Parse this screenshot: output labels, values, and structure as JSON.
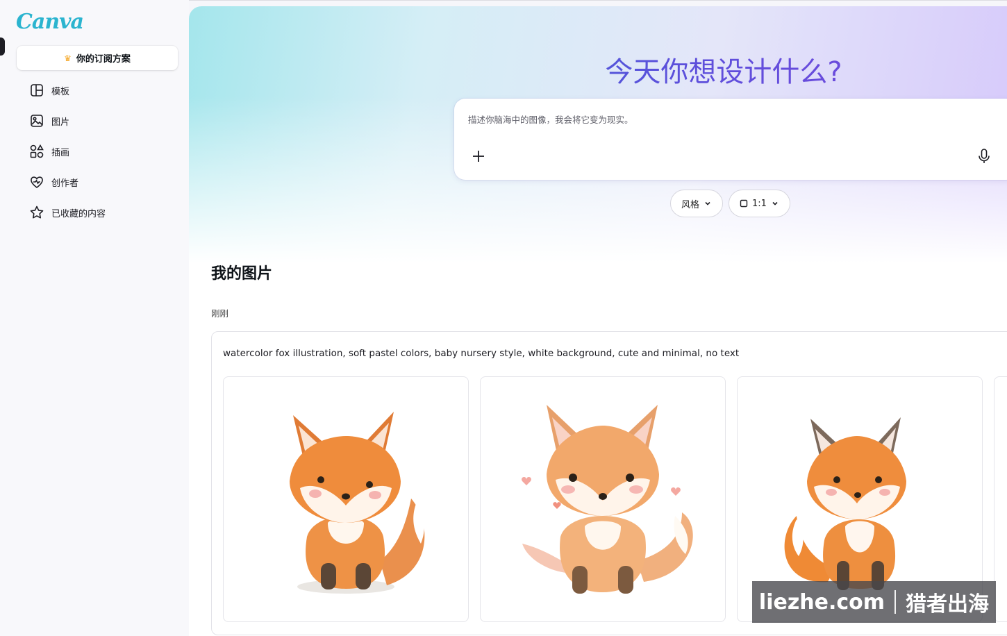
{
  "sidebar": {
    "logo": "Canva",
    "plan_label": "你的订阅方案",
    "items": [
      {
        "label": "模板",
        "icon": "template-icon"
      },
      {
        "label": "图片",
        "icon": "image-icon"
      },
      {
        "label": "插画",
        "icon": "shapes-icon"
      },
      {
        "label": "创作者",
        "icon": "heart-icon"
      },
      {
        "label": "已收藏的内容",
        "icon": "star-icon"
      }
    ]
  },
  "hero": {
    "title": "今天你想设计什么?",
    "prompt_placeholder": "描述你脑海中的图像，我会将它变为现实。",
    "style_chip": "风格",
    "ratio_chip": "1:1"
  },
  "gallery": {
    "section_title": "我的图片",
    "time_label": "刚刚",
    "prompt_text": "watercolor fox illustration, soft pastel colors, baby nursery style, white background, cute and minimal, no text"
  },
  "watermark": {
    "left": "liezhe.com",
    "right": "猎者出海"
  },
  "colors": {
    "accent": "#8b3dff",
    "logo": "#2bb4cf"
  }
}
